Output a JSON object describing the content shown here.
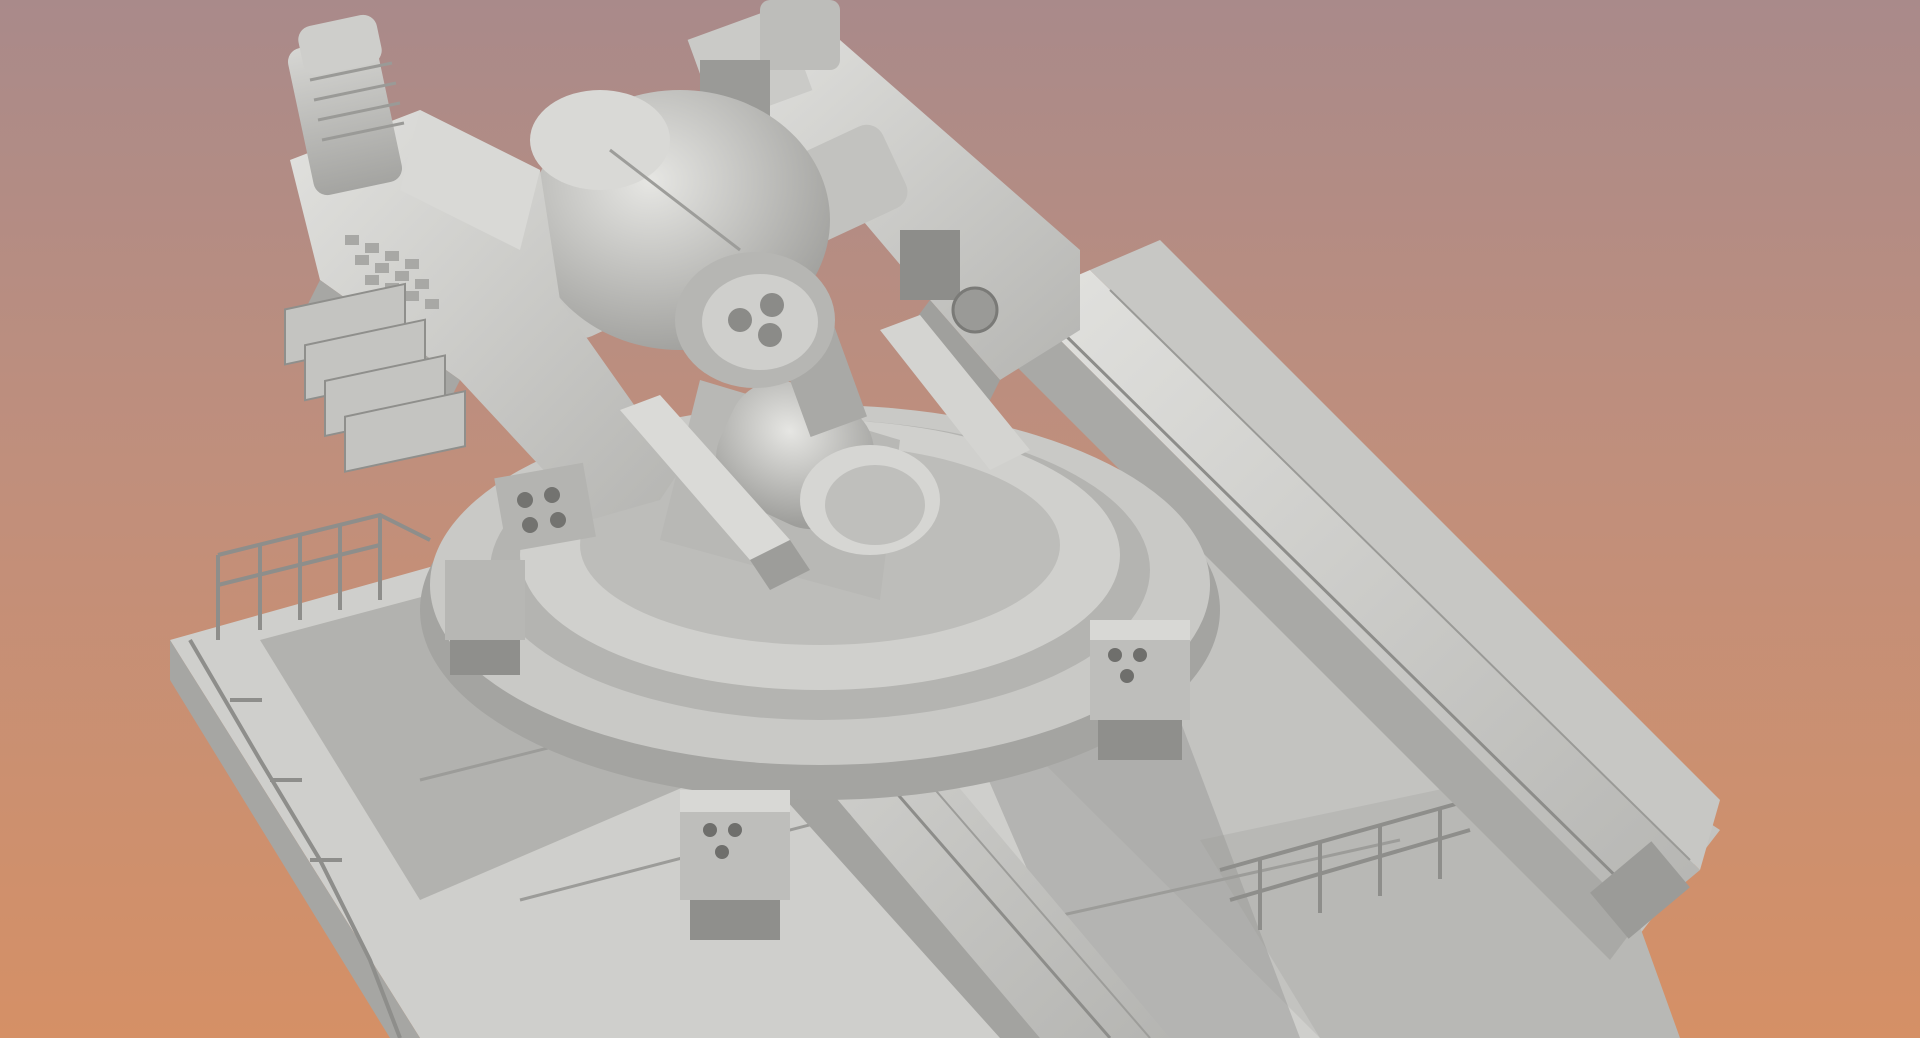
{
  "scene": {
    "background": {
      "top_color": "#a98a8a",
      "mid_color": "#c08f7c",
      "bottom_color": "#d59066"
    },
    "model": {
      "subject": "turret-model",
      "base_color": "#c9c9c6",
      "light_color": "#dededb",
      "mid_color": "#b3b3b0",
      "shadow_color": "#8f8f8c",
      "dark_color": "#6f6f6c"
    }
  }
}
